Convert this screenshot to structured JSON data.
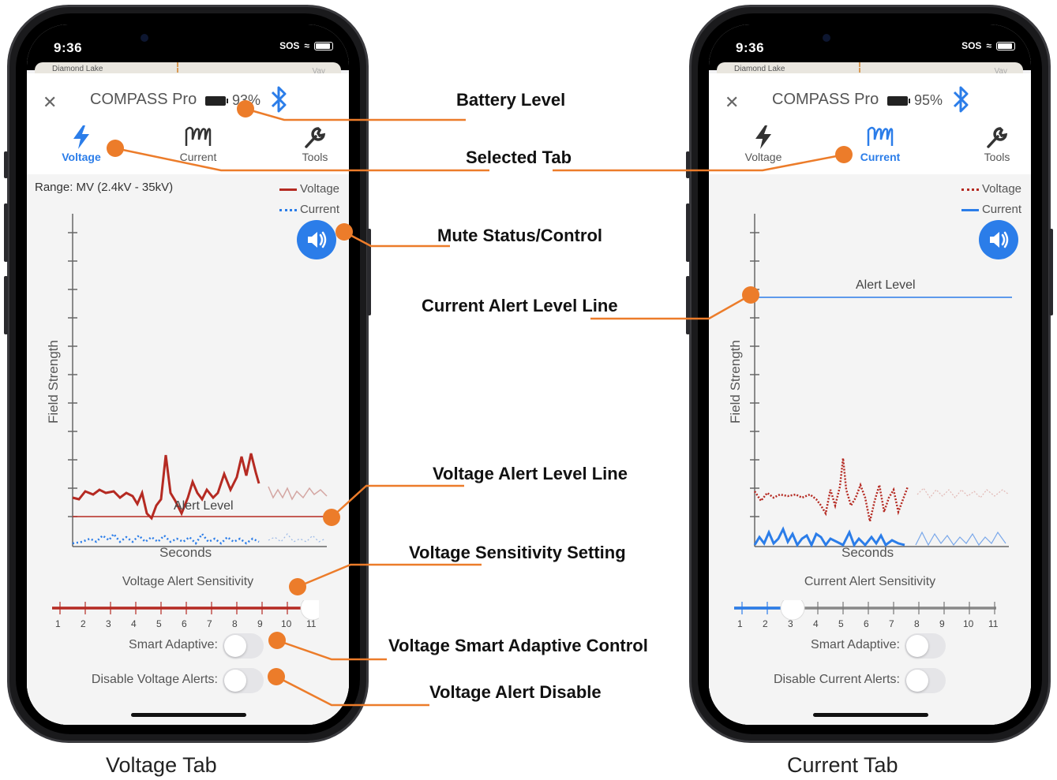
{
  "status_bar": {
    "time": "9:36",
    "carrier": "SOS"
  },
  "map_labels": {
    "left": "Diamond Lake",
    "right": "Vav"
  },
  "phones": [
    {
      "device_name": "COMPASS Pro",
      "battery_percent": "93%",
      "tabs": [
        {
          "label": "Voltage",
          "icon": "lightning-icon",
          "active": true
        },
        {
          "label": "Current",
          "icon": "coil-icon",
          "active": false
        },
        {
          "label": "Tools",
          "icon": "wrench-icon",
          "active": false
        }
      ],
      "range": "Range: MV (2.4kV - 35kV)",
      "legend": [
        {
          "label": "Voltage",
          "style": "solid",
          "color": "#b52a22"
        },
        {
          "label": "Current",
          "style": "dotted",
          "color": "#2b7de9"
        }
      ],
      "y_axis_label": "Field Strength",
      "x_axis_label": "Seconds",
      "alert_level_label": "Alert Level",
      "sensitivity_label": "Voltage Alert Sensitivity",
      "slider_ticks": [
        "1",
        "2",
        "3",
        "4",
        "5",
        "6",
        "7",
        "8",
        "9",
        "10",
        "11"
      ],
      "slider_value": 11,
      "smart_adaptive_label": "Smart Adaptive:",
      "disable_label": "Disable Voltage Alerts:"
    },
    {
      "device_name": "COMPASS Pro",
      "battery_percent": "95%",
      "tabs": [
        {
          "label": "Voltage",
          "icon": "lightning-icon",
          "active": false
        },
        {
          "label": "Current",
          "icon": "coil-icon",
          "active": true
        },
        {
          "label": "Tools",
          "icon": "wrench-icon",
          "active": false
        }
      ],
      "range": "",
      "legend": [
        {
          "label": "Voltage",
          "style": "dotted",
          "color": "#b52a22"
        },
        {
          "label": "Current",
          "style": "solid",
          "color": "#2b7de9"
        }
      ],
      "y_axis_label": "Field Strength",
      "x_axis_label": "Seconds",
      "alert_level_label": "Alert Level",
      "sensitivity_label": "Current Alert Sensitivity",
      "slider_ticks": [
        "1",
        "2",
        "3",
        "4",
        "5",
        "6",
        "7",
        "8",
        "9",
        "10",
        "11"
      ],
      "slider_value": 3,
      "smart_adaptive_label": "Smart Adaptive:",
      "disable_label": "Disable Current Alerts:"
    }
  ],
  "callouts": {
    "battery_level": "Battery Level",
    "selected_tab": "Selected Tab",
    "mute_status": "Mute Status/Control",
    "current_alert_line": "Current Alert Level Line",
    "voltage_alert_line": "Voltage Alert Level Line",
    "voltage_sensitivity": "Voltage Sensitivity Setting",
    "voltage_smart_adaptive": "Voltage Smart Adaptive Control",
    "voltage_alert_disable": "Voltage Alert Disable"
  },
  "captions": {
    "left": "Voltage Tab",
    "right": "Current Tab"
  },
  "colors": {
    "accent": "#2b7de9",
    "voltage": "#b52a22",
    "callout": "#ec7c2a"
  }
}
